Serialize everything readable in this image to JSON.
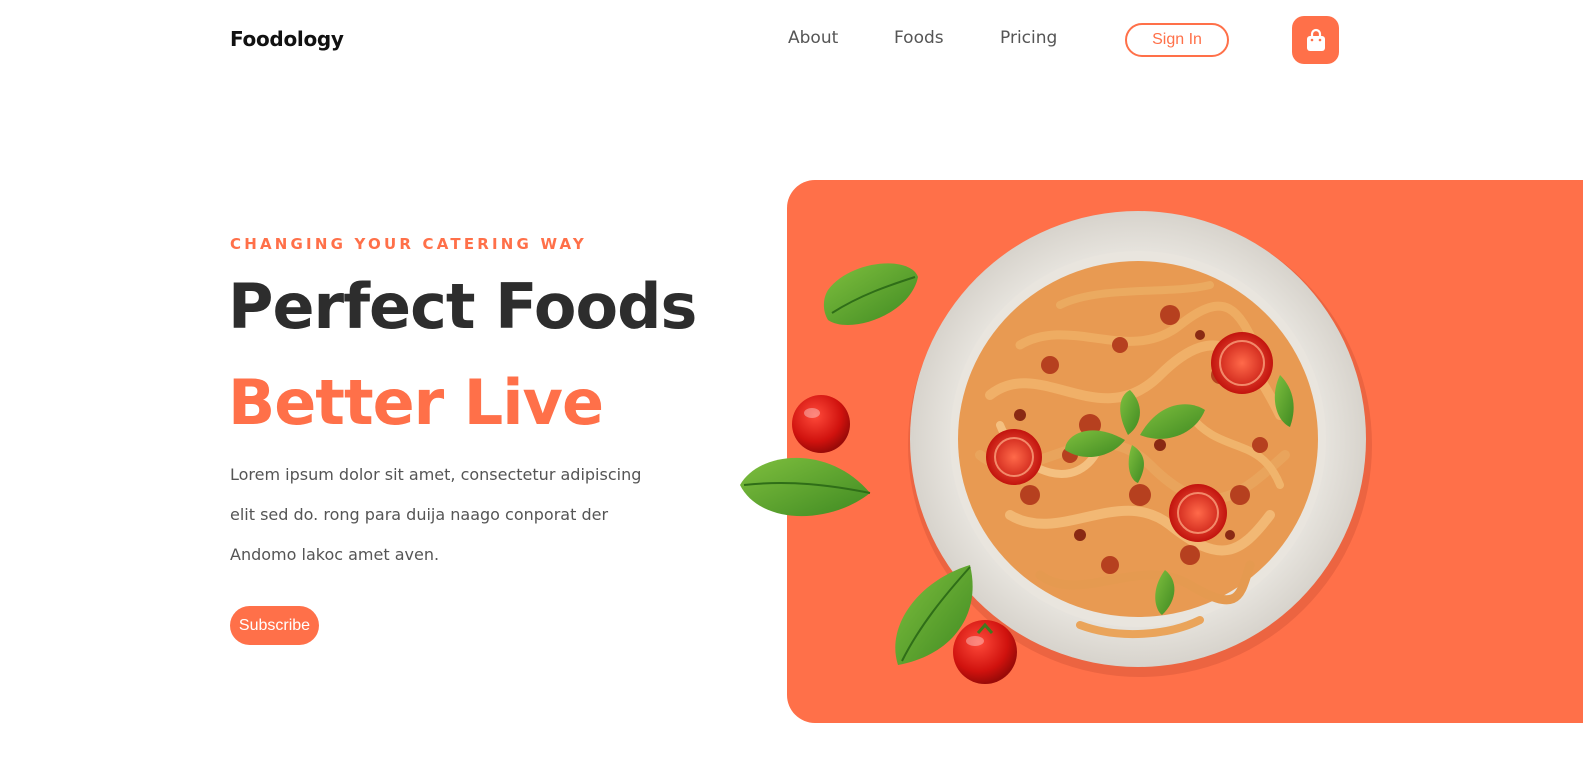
{
  "header": {
    "brand": "Foodology",
    "nav": [
      "About",
      "Foods",
      "Pricing"
    ],
    "signin_label": "Sign In",
    "cart_icon": "shopping-bag-icon"
  },
  "hero": {
    "eyebrow": "CHANGING YOUR CATERING WAY",
    "headline_line1": "Perfect Foods",
    "headline_line2": "Better Live",
    "body_lines": [
      "Lorem ipsum dolor sit amet, consectetur adipiscing",
      "elit sed do. rong para duija naago conporat der",
      "Andomo lakoc amet aven."
    ],
    "subscribe_label": "Subscribe",
    "image_subject": "pasta-dish-with-tomatoes-and-basil"
  },
  "colors": {
    "accent": "#ff7049",
    "text_dark": "#2d2d2d",
    "text_muted": "#555555",
    "background": "#ffffff"
  }
}
